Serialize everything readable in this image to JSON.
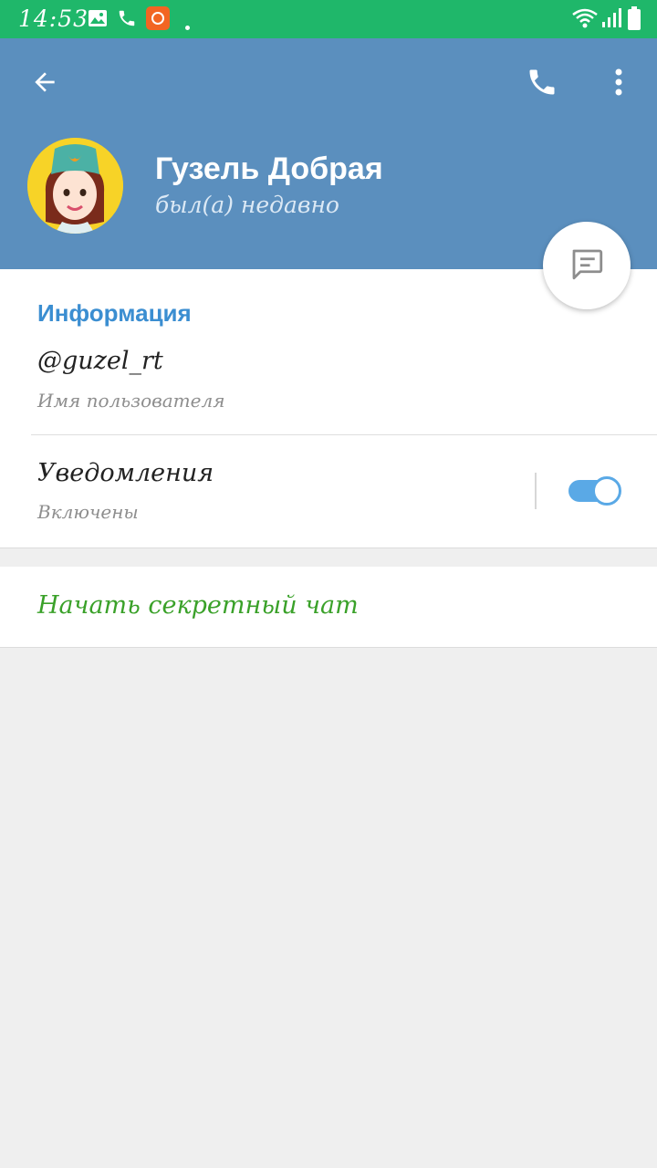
{
  "status_bar": {
    "time": "14:53"
  },
  "header": {
    "name": "Гузель Добрая",
    "status": "был(а) недавно"
  },
  "info": {
    "section_title": "Информация",
    "username": "@guzel_rt",
    "username_caption": "Имя пользователя",
    "notifications_label": "Уведомления",
    "notifications_state": "Включены",
    "notifications_enabled": true
  },
  "actions": {
    "secret_chat": "Начать секретный чат"
  },
  "colors": {
    "status_bar": "#1fb76a",
    "header": "#5b8fbe",
    "accent": "#3b8ed1",
    "secret_chat": "#3aa129",
    "toggle": "#5aa9e6"
  },
  "icons": [
    "back-arrow-icon",
    "phone-icon",
    "more-vert-icon",
    "message-icon",
    "wifi-icon",
    "signal-icon",
    "battery-icon"
  ]
}
